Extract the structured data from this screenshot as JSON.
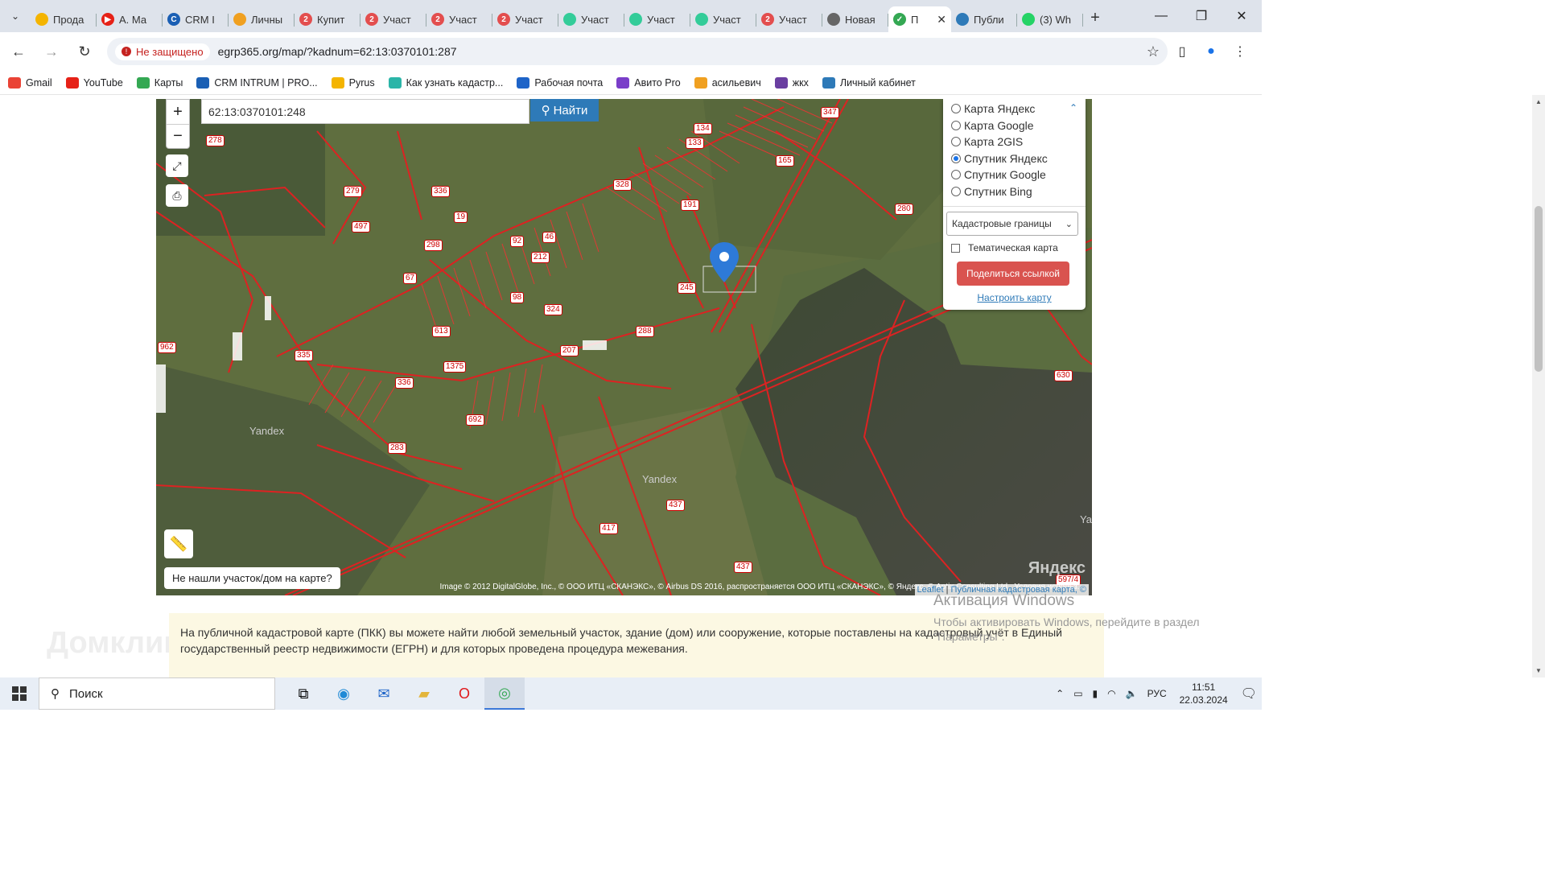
{
  "browser": {
    "tabs": [
      {
        "label": "Прода",
        "color": "#f4b400",
        "glyph": ""
      },
      {
        "label": "А. Ма",
        "color": "#e62117",
        "glyph": "▶"
      },
      {
        "label": "CRM I",
        "color": "#1a5fb4",
        "glyph": "C"
      },
      {
        "label": "Личны",
        "color": "#f0a020",
        "glyph": ""
      },
      {
        "label": "Купит",
        "color": "#e34e4e",
        "glyph": "2"
      },
      {
        "label": "Участ",
        "color": "#e34e4e",
        "glyph": "2"
      },
      {
        "label": "Участ",
        "color": "#e34e4e",
        "glyph": "2"
      },
      {
        "label": "Участ",
        "color": "#e34e4e",
        "glyph": "2"
      },
      {
        "label": "Участ",
        "color": "#3c9",
        "glyph": ""
      },
      {
        "label": "Участ",
        "color": "#3c9",
        "glyph": ""
      },
      {
        "label": "Участ",
        "color": "#3c9",
        "glyph": ""
      },
      {
        "label": "Участ",
        "color": "#e34e4e",
        "glyph": "2"
      },
      {
        "label": "Новая",
        "color": "#666",
        "glyph": ""
      }
    ],
    "active_tab": {
      "label": "П",
      "close": "✕"
    },
    "after_tabs": [
      {
        "label": "Публи",
        "color": "#2e7ab8",
        "glyph": ""
      },
      {
        "label": "(3) Wh",
        "color": "#25d366",
        "glyph": ""
      }
    ],
    "new_tab": "+",
    "window_controls": [
      "—",
      "❐",
      "✕"
    ],
    "security_label": "Не защищено",
    "url": "egrp365.org/map/?kadnum=62:13:0370101:287",
    "bookmarks": [
      {
        "label": "Gmail",
        "color": "#ea4335"
      },
      {
        "label": "YouTube",
        "color": "#e62117"
      },
      {
        "label": "Карты",
        "color": "#34a853"
      },
      {
        "label": "CRM INTRUM | PRO...",
        "color": "#1a5fb4"
      },
      {
        "label": "Pyrus",
        "color": "#f4b400"
      },
      {
        "label": "Как узнать кадастр...",
        "color": "#2bb5a8"
      },
      {
        "label": "Рабочая почта",
        "color": "#1e64c8"
      },
      {
        "label": "Авито Pro",
        "color": "#7a3ec9"
      },
      {
        "label": "асильевич",
        "color": "#f0a020"
      },
      {
        "label": "жкх",
        "color": "#6a3ea1"
      },
      {
        "label": "Личный кабинет",
        "color": "#2e7ab8"
      }
    ]
  },
  "map": {
    "search_value": "62:13:0370101:248",
    "search_button": "Найти",
    "zoom_in": "+",
    "zoom_out": "−",
    "layers": [
      {
        "label": "Карта Яндекс",
        "selected": false
      },
      {
        "label": "Карта Google",
        "selected": false
      },
      {
        "label": "Карта 2GIS",
        "selected": false
      },
      {
        "label": "Спутник Яндекс",
        "selected": true
      },
      {
        "label": "Спутник Google",
        "selected": false
      },
      {
        "label": "Спутник Bing",
        "selected": false
      }
    ],
    "overlay_select": "Кадастровые границы",
    "thematic_label": "Тематическая карта",
    "share_button": "Поделиться ссылкой",
    "configure_link": "Настроить карту",
    "not_found_button": "Не нашли участок/дом на карте?",
    "attribution": "Image © 2012 DigitalGlobe, Inc., © ООО ИТЦ «СКАНЭКС», © Airbus DS 2016, распространяется ООО ИТЦ «СКАНЭКС», © Яндекс, © Aptix Consulting Ltd., Условия использ...",
    "attribution_links": {
      "leaflet": "Leaflet",
      "pkk": "Публичная кадастровая карта, ©"
    },
    "yandex_logo": "Яндекс",
    "parcel_labels": [
      "278",
      "279",
      "497",
      "336",
      "19",
      "298",
      "67",
      "92",
      "46",
      "212",
      "134",
      "133",
      "347",
      "165",
      "191",
      "328",
      "245",
      "280",
      "98",
      "324",
      "613",
      "335",
      "1375",
      "336",
      "692",
      "288",
      "207",
      "283",
      "962",
      "437",
      "417",
      "437",
      "630",
      "597/4"
    ],
    "watermarks": [
      "Yandex",
      "Yandex",
      "Yan"
    ]
  },
  "info_text": "На публичной кадастровой карте (ПКК) вы можете найти любой земельный участок, здание (дом) или сооружение, которые поставлены на кадастровый учёт в Единый государственный реестр недвижимости (ЕГРН) и для которых проведена процедура межевания.",
  "windows_activation": {
    "title": "Активация Windows",
    "text": "Чтобы активировать Windows, перейдите в раздел \"Параметры\"."
  },
  "site_logo": "Домклик",
  "taskbar": {
    "search_placeholder": "Поиск",
    "language": "РУС",
    "time": "11:51",
    "date": "22.03.2024"
  }
}
